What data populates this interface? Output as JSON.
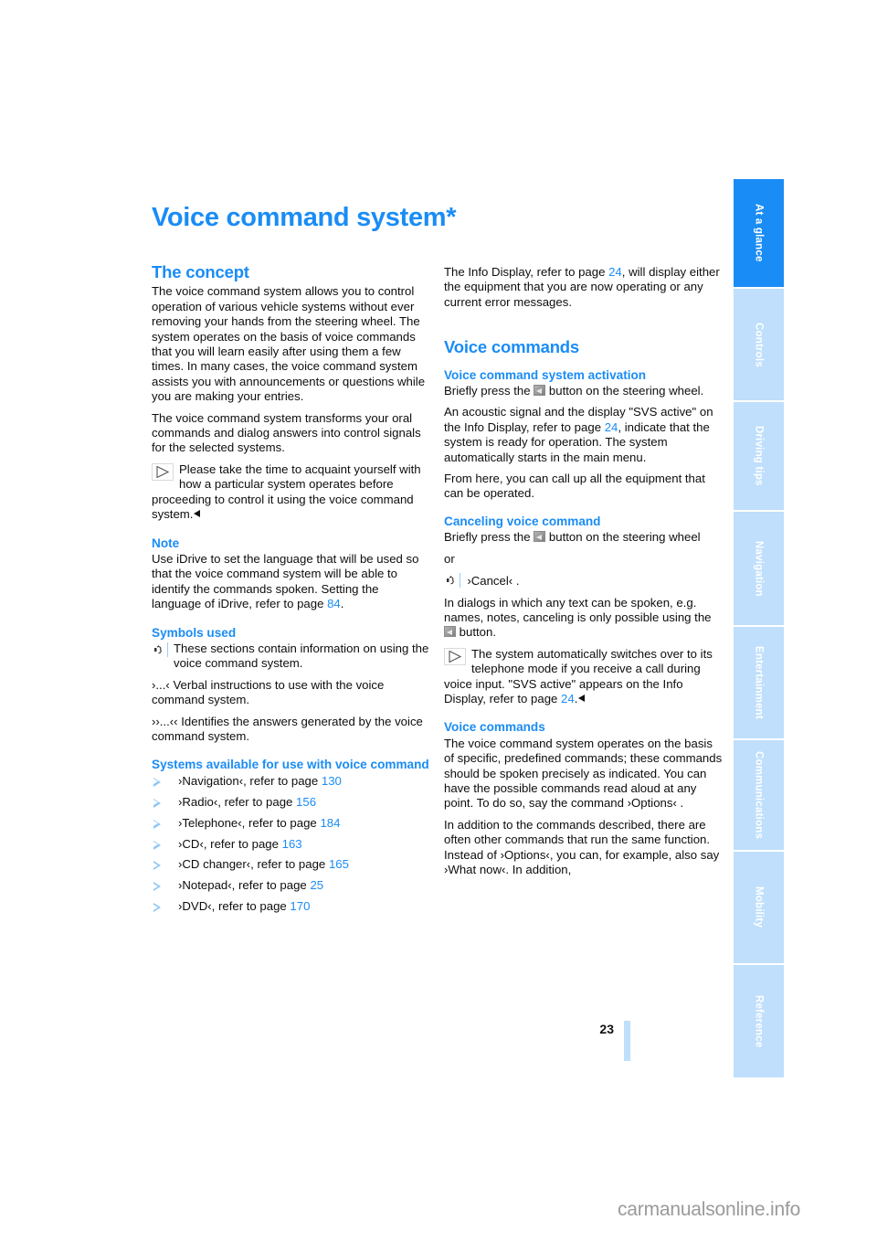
{
  "document": {
    "title": "Voice command system*",
    "page_number": "23",
    "watermark": "carmanualsonline.info"
  },
  "sidebar": {
    "tabs": [
      {
        "label": "At a glance",
        "active": true
      },
      {
        "label": "Controls",
        "active": false
      },
      {
        "label": "Driving tips",
        "active": false
      },
      {
        "label": "Navigation",
        "active": false
      },
      {
        "label": "Entertainment",
        "active": false
      },
      {
        "label": "Communications",
        "active": false
      },
      {
        "label": "Mobility",
        "active": false
      },
      {
        "label": "Reference",
        "active": false
      }
    ]
  },
  "left_column": {
    "concept": {
      "heading": "The concept",
      "p1": "The voice command system allows you to control operation of various vehicle systems without ever removing your hands from the steering wheel. The system operates on the basis of voice commands that you will learn easily after using them a few times. In many cases, the voice command system assists you with announcements or questions while you are making your entries.",
      "p2": "The voice command system transforms your oral commands and dialog answers into control signals for the selected systems.",
      "note": "Please take the time to acquaint yourself with how a particular system operates before proceeding to control it using the voice command system."
    },
    "note": {
      "heading": "Note",
      "text_before": "Use iDrive to set the language that will be used so that the voice command system will be able to identify the commands spoken. Setting the language of iDrive, refer to page",
      "page_ref": "84",
      "text_after": "."
    },
    "symbols": {
      "heading": "Symbols used",
      "item1": "These sections contain information on using the voice command system.",
      "item2_marker": "›...‹",
      "item2": "Verbal instructions to use with the voice command system.",
      "item3_marker": "››...‹‹",
      "item3": "Identifies the answers generated by the voice command system."
    },
    "systems": {
      "heading": "Systems available for use with voice command",
      "items": [
        {
          "command": "›Navigation‹",
          "text": ", refer to page",
          "page": "130"
        },
        {
          "command": "›Radio‹",
          "text": ", refer to page",
          "page": "156"
        },
        {
          "command": "›Telephone‹",
          "text": ", refer to page",
          "page": "184"
        },
        {
          "command": "›CD‹",
          "text": ", refer to page",
          "page": "163"
        },
        {
          "command": "›CD changer‹",
          "text": ", refer to page",
          "page": "165"
        },
        {
          "command": "›Notepad‹",
          "text": ", refer to page",
          "page": "25"
        },
        {
          "command": "›DVD‹",
          "text": ", refer to page",
          "page": "170"
        }
      ]
    }
  },
  "right_column": {
    "intro": {
      "text_before": "The Info Display, refer to page",
      "page_ref": "24",
      "text_after": ", will display either the equipment that you are now operating or any current error messages."
    },
    "voice_commands_1": {
      "heading": "Voice commands"
    },
    "activation": {
      "heading": "Voice command system activation",
      "p1_before": "Briefly press the",
      "p1_after": "button on the steering wheel.",
      "p2_before": "An acoustic signal and the display \"SVS active\" on the Info Display, refer to page",
      "p2_page": "24",
      "p2_after": ", indicate that the system is ready for operation. The system automatically starts in the main menu.",
      "p3": "From here, you can call up all the equipment that can be operated."
    },
    "canceling": {
      "heading": "Canceling voice command",
      "p1_before": "Briefly press the",
      "p1_after": "button on the steering wheel",
      "or": "or",
      "cancel_command": "›Cancel‹ .",
      "p2_before": "In dialogs in which any text can be spoken, e.g. names, notes, canceling is only possible using the",
      "p2_after": "button.",
      "note_before": "The system automatically switches over to its telephone mode if you receive a call during voice input. \"SVS active\" appears on the Info Display, refer to page",
      "note_page": "24",
      "note_after": "."
    },
    "voice_commands_2": {
      "heading": "Voice commands",
      "p1_before": "The voice command system operates on the basis of specific, predefined commands; these commands should be spoken precisely as indicated. You can have the possible commands read aloud at any point. To do so, say the command",
      "p1_cmd": "›Options‹",
      "p1_after": ".",
      "p2_before": "In addition to the commands described, there are often other commands that run the same function. Instead of",
      "p2_cmd1": "›Options‹",
      "p2_mid": ", you can, for example, also say",
      "p2_cmd2": "›What now‹",
      "p2_after": ". In addition,"
    }
  },
  "colors": {
    "accent": "#1a8cf5",
    "tab_inactive": "#bfdffc",
    "bullet": "#8fc6f5",
    "text": "#0d0d0d",
    "watermark": "#9a9a9a"
  }
}
